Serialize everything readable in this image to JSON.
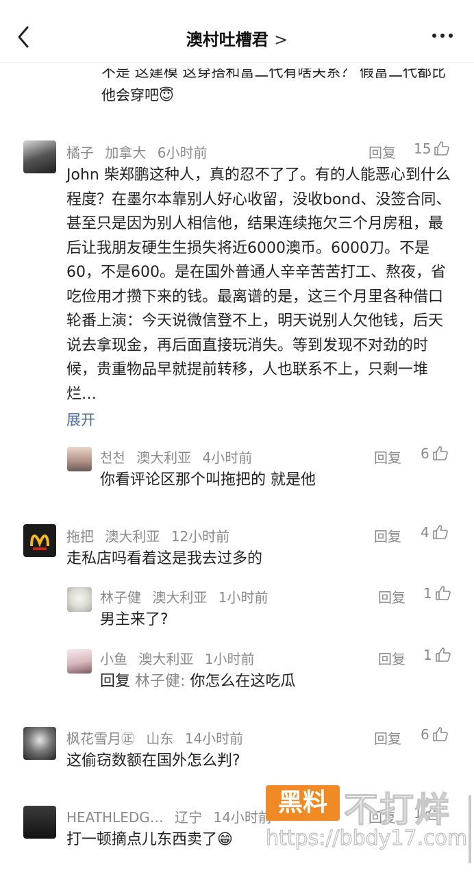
{
  "nav": {
    "title": "澳村吐槽君",
    "title_chevron": ">",
    "back_icon": "chevron-left-icon",
    "more_icon": "more-dots-icon"
  },
  "partial_comment": {
    "text": "不是 这建模 这穿搭和富二代有啥关系？ 假富二代都比他会穿吧😇"
  },
  "comments": [
    {
      "user": "橘子",
      "location": "加拿大",
      "time": "6小时前",
      "reply_label": "回复",
      "likes": "15",
      "text": "John 柴郑鹏这种人，真的忍不了了。有的人能恶心到什么程度？在墨尔本靠别人好心收留，没收bond、没签合同、甚至只是因为别人相信他，结果连续拖欠三个月房租，最后让我朋友硬生生损失将近6000澳币。6000刀。不是60，不是600。是在国外普通人辛辛苦苦打工、熬夜，省吃俭用才攒下来的钱。最离谱的是，这三个月里各种借口轮番上演：今天说微信登不上，明天说别人欠他钱，后天说去拿现金，再后面直接玩消失。等到发现不对劲的时候，贵重物品早就提前转移，人也联系不上，只剩一堆烂…",
      "expand": "展开"
    },
    {
      "user": "천천",
      "location": "澳大利亚",
      "time": "4小时前",
      "reply_label": "回复",
      "likes": "6",
      "text": "你看评论区那个叫拖把的 就是他"
    },
    {
      "user": "拖把",
      "location": "澳大利亚",
      "time": "12小时前",
      "reply_label": "回复",
      "likes": "4",
      "text": "走私店吗看着这是我去过多的"
    },
    {
      "user": "林子健",
      "location": "澳大利亚",
      "time": "1小时前",
      "reply_label": "回复",
      "likes": "1",
      "text": "男主来了?"
    },
    {
      "user": "小鱼",
      "location": "澳大利亚",
      "time": "1小时前",
      "reply_label": "回复",
      "likes": "1",
      "reply_prefix": "回复",
      "reply_target": "林子健:",
      "text": "你怎么在这吃瓜"
    },
    {
      "user": "枫花雪月㊣",
      "location": "山东",
      "time": "14小时前",
      "reply_label": "回复",
      "likes": "6",
      "text": "这偷窃数额在国外怎么判?"
    },
    {
      "user": "HEATHLEDG…",
      "location": "辽宁",
      "time": "14小时前",
      "reply_label": "回复",
      "likes": "1",
      "text": "打一顿摘点儿东西卖了😁"
    }
  ],
  "watermark": {
    "badge": "黑料",
    "brand": "不打烊",
    "url": "https://bbdy17.com"
  },
  "colors": {
    "meta": "#8a8a8a",
    "link": "#4a6a9a",
    "watermark_badge": "#f08a24"
  }
}
